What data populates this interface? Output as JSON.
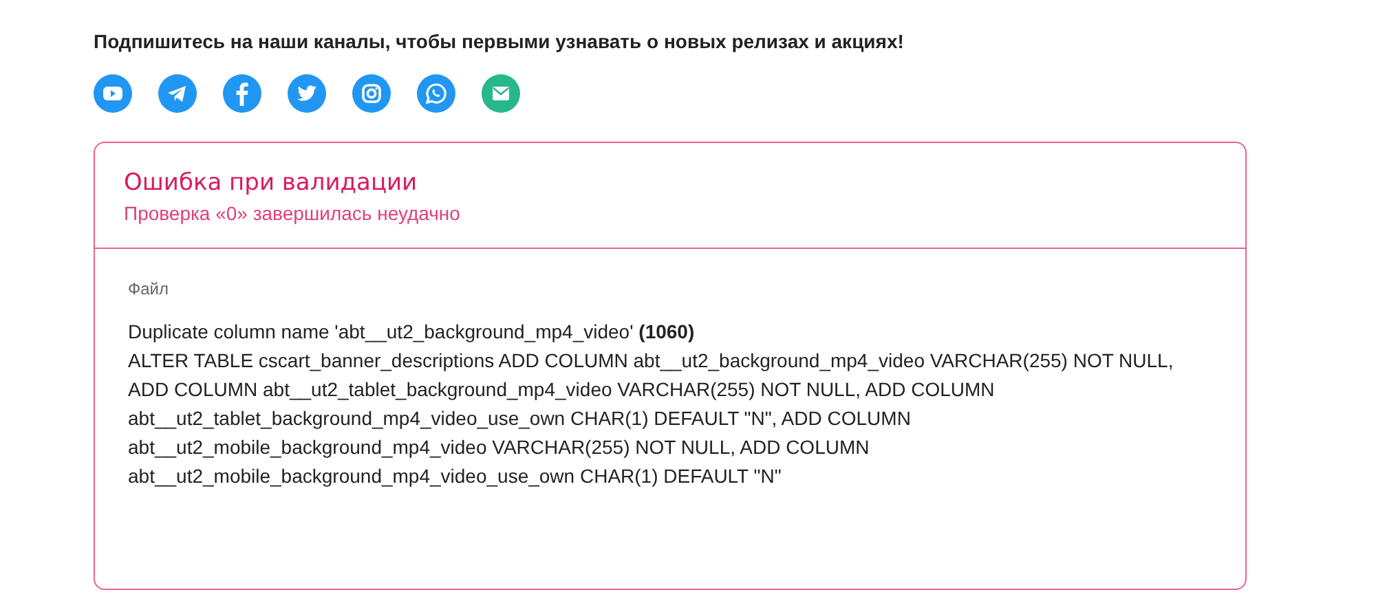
{
  "subscribe": {
    "heading": "Подпишитесь на наши каналы, чтобы первыми узнавать о новых релизах и акциях!",
    "channels": [
      {
        "kind": "youtube",
        "color": "#2196f3"
      },
      {
        "kind": "telegram",
        "color": "#2196f3"
      },
      {
        "kind": "facebook",
        "color": "#2196f3"
      },
      {
        "kind": "twitter",
        "color": "#2196f3"
      },
      {
        "kind": "instagram",
        "color": "#2196f3"
      },
      {
        "kind": "whatsapp",
        "color": "#2196f3"
      },
      {
        "kind": "email",
        "color": "#26b88a"
      }
    ]
  },
  "error_card": {
    "title": "Ошибка при валидации",
    "subtitle": "Проверка «0» завершилась неудачно",
    "label": "Файл",
    "message_lines": [
      "Duplicate column name 'abt__ut2_background_mp4_video' **(1060)**",
      "ALTER TABLE cscart_banner_descriptions ADD COLUMN abt__ut2_background_mp4_video VARCHAR(255) NOT NULL,",
      "ADD COLUMN abt__ut2_tablet_background_mp4_video VARCHAR(255) NOT NULL, ADD COLUMN",
      "abt__ut2_tablet_background_mp4_video_use_own CHAR(1) DEFAULT \"N\", ADD COLUMN",
      "abt__ut2_mobile_background_mp4_video VARCHAR(255) NOT NULL, ADD COLUMN",
      "abt__ut2_mobile_background_mp4_video_use_own CHAR(1) DEFAULT \"N\""
    ]
  }
}
